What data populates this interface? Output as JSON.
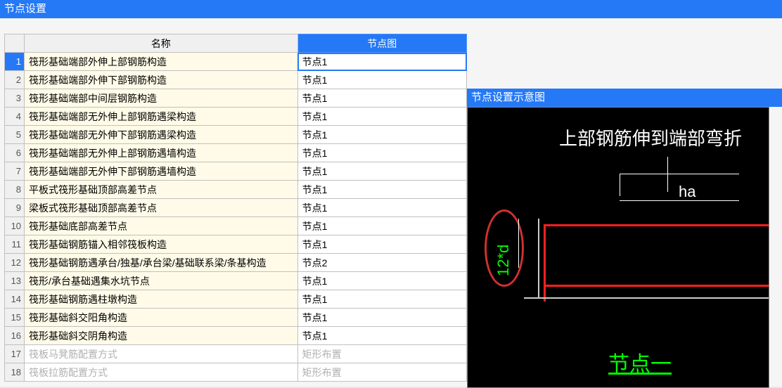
{
  "window_title": "节点设置",
  "columns": {
    "name": "名称",
    "node": "节点图"
  },
  "rows": [
    {
      "n": 1,
      "name": "筏形基础端部外伸上部钢筋构造",
      "node": "节点1",
      "selected": true
    },
    {
      "n": 2,
      "name": "筏形基础端部外伸下部钢筋构造",
      "node": "节点1"
    },
    {
      "n": 3,
      "name": "筏形基础端部中间层钢筋构造",
      "node": "节点1"
    },
    {
      "n": 4,
      "name": "筏形基础端部无外伸上部钢筋遇梁构造",
      "node": "节点1"
    },
    {
      "n": 5,
      "name": "筏形基础端部无外伸下部钢筋遇梁构造",
      "node": "节点1"
    },
    {
      "n": 6,
      "name": "筏形基础端部无外伸上部钢筋遇墙构造",
      "node": "节点1"
    },
    {
      "n": 7,
      "name": "筏形基础端部无外伸下部钢筋遇墙构造",
      "node": "节点1"
    },
    {
      "n": 8,
      "name": "平板式筏形基础顶部高差节点",
      "node": "节点1"
    },
    {
      "n": 9,
      "name": "梁板式筏形基础顶部高差节点",
      "node": "节点1"
    },
    {
      "n": 10,
      "name": "筏形基础底部高差节点",
      "node": "节点1"
    },
    {
      "n": 11,
      "name": "筏形基础钢筋锚入相邻筏板构造",
      "node": "节点1"
    },
    {
      "n": 12,
      "name": "筏形基础钢筋遇承台/独基/承台梁/基础联系梁/条基构造",
      "node": "节点2"
    },
    {
      "n": 13,
      "name": "筏形/承台基础遇集水坑节点",
      "node": "节点1"
    },
    {
      "n": 14,
      "name": "筏形基础钢筋遇柱墩构造",
      "node": "节点1"
    },
    {
      "n": 15,
      "name": "筏形基础斜交阳角构造",
      "node": "节点1"
    },
    {
      "n": 16,
      "name": "筏形基础斜交阴角构造",
      "node": "节点1"
    },
    {
      "n": 17,
      "name": "筏板马凳筋配置方式",
      "node": "矩形布置",
      "disabled": true
    },
    {
      "n": 18,
      "name": "筏板拉筋配置方式",
      "node": "矩形布置",
      "disabled": true
    }
  ],
  "preview": {
    "title": "节点设置示意图",
    "heading": "上部钢筋伸到端部弯折",
    "ha": "ha",
    "dim": "12*d",
    "node_label": "节点一"
  }
}
